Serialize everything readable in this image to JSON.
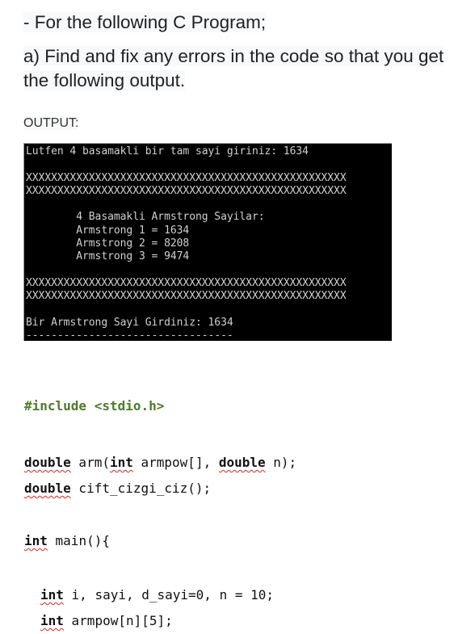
{
  "question": {
    "line1": "- For the following C Program;",
    "line2": "a) Find and fix any errors in the code so that you get the following output."
  },
  "output_label": "OUTPUT:",
  "console": {
    "lines": [
      "Lutfen 4 basamakli bir tam sayi giriniz: 1634",
      "",
      "XXXXXXXXXXXXXXXXXXXXXXXXXXXXXXXXXXXXXXXXXXXXXXXXXXX",
      "XXXXXXXXXXXXXXXXXXXXXXXXXXXXXXXXXXXXXXXXXXXXXXXXXXX",
      "",
      "        4 Basamakli Armstrong Sayilar:",
      "        Armstrong 1 = 1634",
      "        Armstrong 2 = 8208",
      "        Armstrong 3 = 9474",
      "",
      "XXXXXXXXXXXXXXXXXXXXXXXXXXXXXXXXXXXXXXXXXXXXXXXXXXX",
      "XXXXXXXXXXXXXXXXXXXXXXXXXXXXXXXXXXXXXXXXXXXXXXXXXXX",
      "",
      "Bir Armstrong Sayi Girdiniz: 1634",
      "---------------------------------"
    ]
  },
  "code": {
    "include": "#include <stdio.h>",
    "proto1": {
      "kw1": "double",
      "rest1": " arm(",
      "kw2": "int",
      "rest2": " armpow[], ",
      "kw3": "double",
      "rest3": " n);"
    },
    "proto2": {
      "kw1": "double",
      "rest1": " cift_cizgi_ciz();"
    },
    "main": {
      "kw": "int",
      "rest": " main(){"
    },
    "decl1": {
      "kw": "int",
      "rest": " i, sayi, d_sayi=0, n = 10;"
    },
    "decl2": {
      "kw": "int",
      "rest": " armpow[n][5];"
    }
  }
}
